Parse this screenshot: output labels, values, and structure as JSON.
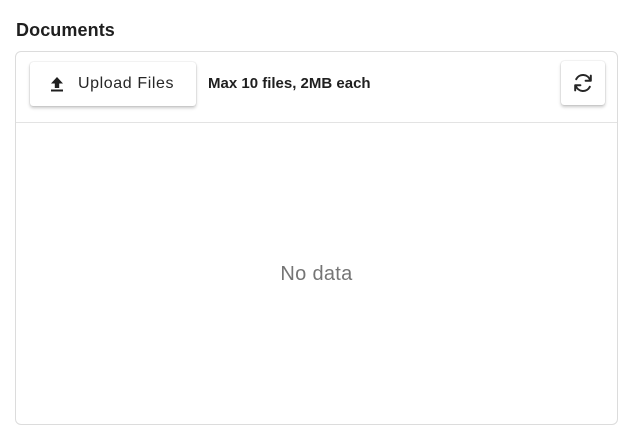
{
  "section": {
    "title": "Documents"
  },
  "toolbar": {
    "upload_label": "Upload Files",
    "upload_icon": "upload-icon",
    "limit_text": "Max 10 files, 2MB each",
    "refresh_icon": "refresh-icon"
  },
  "list": {
    "empty_text": "No data"
  },
  "colors": {
    "text_primary": "#1f1f1f",
    "text_muted": "#757575",
    "border": "#dcdcdc"
  }
}
